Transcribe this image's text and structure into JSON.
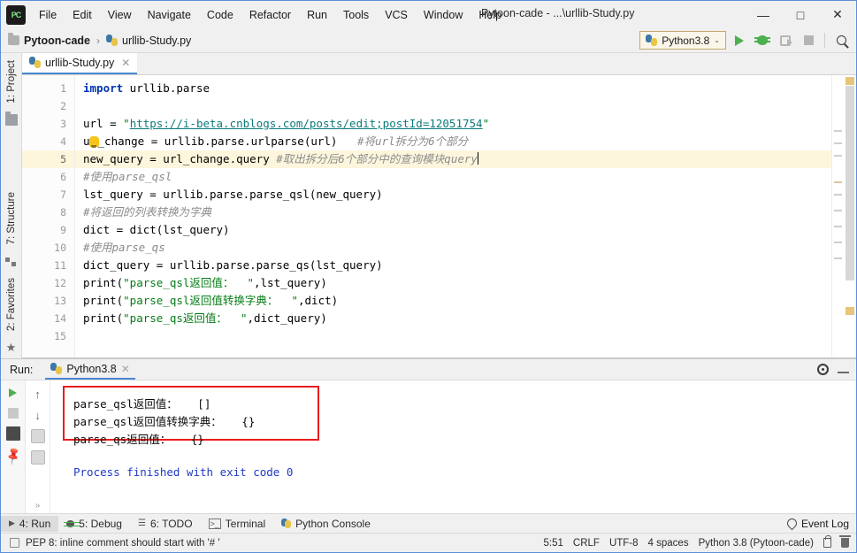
{
  "window": {
    "title": "Pytoon-cade - ...\\urllib-Study.py",
    "minimize_label": "—",
    "maximize_label": "□",
    "close_label": "✕",
    "logo_label": "PC"
  },
  "menubar": {
    "items": [
      {
        "label": "File",
        "mnemonic": "F"
      },
      {
        "label": "Edit",
        "mnemonic": "E"
      },
      {
        "label": "View",
        "mnemonic": "V"
      },
      {
        "label": "Navigate",
        "mnemonic": "N"
      },
      {
        "label": "Code",
        "mnemonic": "C"
      },
      {
        "label": "Refactor",
        "mnemonic": "R"
      },
      {
        "label": "Run",
        "mnemonic": "u"
      },
      {
        "label": "Tools",
        "mnemonic": "T"
      },
      {
        "label": "VCS",
        "mnemonic": "S"
      },
      {
        "label": "Window",
        "mnemonic": "W"
      },
      {
        "label": "Help",
        "mnemonic": "H"
      }
    ]
  },
  "navbar": {
    "project": "Pytoon-cade",
    "separator": "›",
    "file": "urllib-Study.py",
    "run_config": "Python3.8",
    "chevron": "⌄",
    "icons": {
      "folder": "folder-icon",
      "python_file": "python-file-icon",
      "run": "run-icon",
      "debug": "debug-icon",
      "coverage": "run-with-coverage-icon",
      "stop": "stop-icon",
      "search": "search-everywhere-icon"
    }
  },
  "left_rail": {
    "top": [
      {
        "label": "1: Project",
        "icon": "project-folder-icon"
      }
    ],
    "bottom": [
      {
        "label": "7: Structure",
        "icon": "structure-icon"
      },
      {
        "label": "2: Favorites",
        "icon": "star-icon"
      }
    ]
  },
  "editor": {
    "tab": {
      "label": "urllib-Study.py",
      "close": "✕",
      "icon": "python-file-icon"
    },
    "current_line": 5,
    "line_numbers": [
      "1",
      "2",
      "3",
      "4",
      "5",
      "6",
      "7",
      "8",
      "9",
      "10",
      "11",
      "12",
      "13",
      "14",
      "15"
    ],
    "lines": [
      {
        "n": 1,
        "text": "import urllib.parse"
      },
      {
        "n": 2,
        "text": ""
      },
      {
        "n": 3,
        "text": "url = \"https://i-beta.cnblogs.com/posts/edit;postId=12051754\""
      },
      {
        "n": 4,
        "text": "url_change = urllib.parse.urlparse(url)   #将url拆分为6个部分"
      },
      {
        "n": 5,
        "text": "new_query = url_change.query #取出拆分后6个部分中的查询模块query"
      },
      {
        "n": 6,
        "text": "#使用parse_qsl"
      },
      {
        "n": 7,
        "text": "lst_query = urllib.parse.parse_qsl(new_query)"
      },
      {
        "n": 8,
        "text": "#将返回的列表转换为字典"
      },
      {
        "n": 9,
        "text": "dict = dict(lst_query)"
      },
      {
        "n": 10,
        "text": "#使用parse_qs"
      },
      {
        "n": 11,
        "text": "dict_query = urllib.parse.parse_qs(lst_query)"
      },
      {
        "n": 12,
        "text": "print(\"parse_qsl返回值：  \",lst_query)"
      },
      {
        "n": 13,
        "text": "print(\"parse_qsl返回值转换字典：  \",dict)"
      },
      {
        "n": 14,
        "text": "print(\"parse_qs返回值：  \",dict_query)"
      },
      {
        "n": 15,
        "text": ""
      }
    ],
    "tokens": {
      "l1_kw": "import",
      "l1_mod": " urllib.parse",
      "l3_var": "url ",
      "l3_eq": "= ",
      "l3_q1": "\"",
      "l3_url": "https://i-beta.cnblogs.com/posts/edit;postId=12051754",
      "l3_q2": "\"",
      "l4_a": "u",
      "l4_b": "_change = urllib.parse.urlparse(url)   ",
      "l4_cmt": "#将url拆分为6个部分",
      "l5_a": "new_query = url_change.query ",
      "l5_cmt": "#取出拆分后6个部分中的查询模块query",
      "l6_cmt": "#使用parse_qsl",
      "l7": "lst_query = urllib.parse.parse_qsl(new_query)",
      "l8_cmt": "#将返回的列表转换为字典",
      "l9": "dict = dict(lst_query)",
      "l10_cmt": "#使用parse_qs",
      "l11": "dict_query = urllib.parse.parse_qs(lst_query)",
      "l12_a": "print(",
      "l12_str": "\"parse_qsl返回值：  \"",
      "l12_b": ",lst_query)",
      "l13_a": "print(",
      "l13_str": "\"parse_qsl返回值转换字典：  \"",
      "l13_b": ",dict)",
      "l14_a": "print(",
      "l14_str": "\"parse_qs返回值：  \"",
      "l14_b": ",dict_query)"
    }
  },
  "run_window": {
    "label": "Run:",
    "tab": "Python3.8",
    "tab_close": "✕",
    "icons": {
      "rerun": "rerun-icon",
      "stop": "stop-icon",
      "print": "print-icon",
      "pin": "pin-tab-icon",
      "up": "previous-occurrence-icon",
      "down": "next-occurrence-icon",
      "wrap": "soft-wrap-icon",
      "scroll_end": "scroll-to-end-icon",
      "more": "»",
      "settings": "gear-icon",
      "hide": "hide-icon"
    },
    "console": {
      "lines": [
        "parse_qsl返回值：   []",
        "parse_qsl返回值转换字典：   {}",
        "parse_qs返回值：   {}"
      ],
      "exit_line": "Process finished with exit code 0",
      "highlight_color": "#ea1c1c"
    }
  },
  "tool_window_bar": {
    "items": [
      {
        "label": "4: Run",
        "icon": "run-icon",
        "active": true
      },
      {
        "label": "5: Debug",
        "icon": "debug-icon",
        "active": false
      },
      {
        "label": "6: TODO",
        "icon": "todo-icon",
        "active": false
      },
      {
        "label": "Terminal",
        "icon": "terminal-icon",
        "active": false
      },
      {
        "label": "Python Console",
        "icon": "python-console-icon",
        "active": false
      }
    ],
    "event_log": "Event Log"
  },
  "status_bar": {
    "message": "PEP 8: inline comment should start with '# '",
    "caret_position": "5:51",
    "line_separator": "CRLF",
    "encoding": "UTF-8",
    "indent": "4 spaces",
    "interpreter": "Python 3.8 (Pytoon-cade)",
    "lock_icon": "read-only-toggle-icon",
    "trash_icon": "memory-indicator-icon"
  },
  "colors": {
    "accent_blue": "#4a87d1",
    "run_green": "#4caf50",
    "string_green": "#067d17",
    "keyword_blue": "#0033b3",
    "comment_gray": "#8c8c8c",
    "highlight_red": "#ea1c1c",
    "current_line": "#fdf6dd"
  }
}
